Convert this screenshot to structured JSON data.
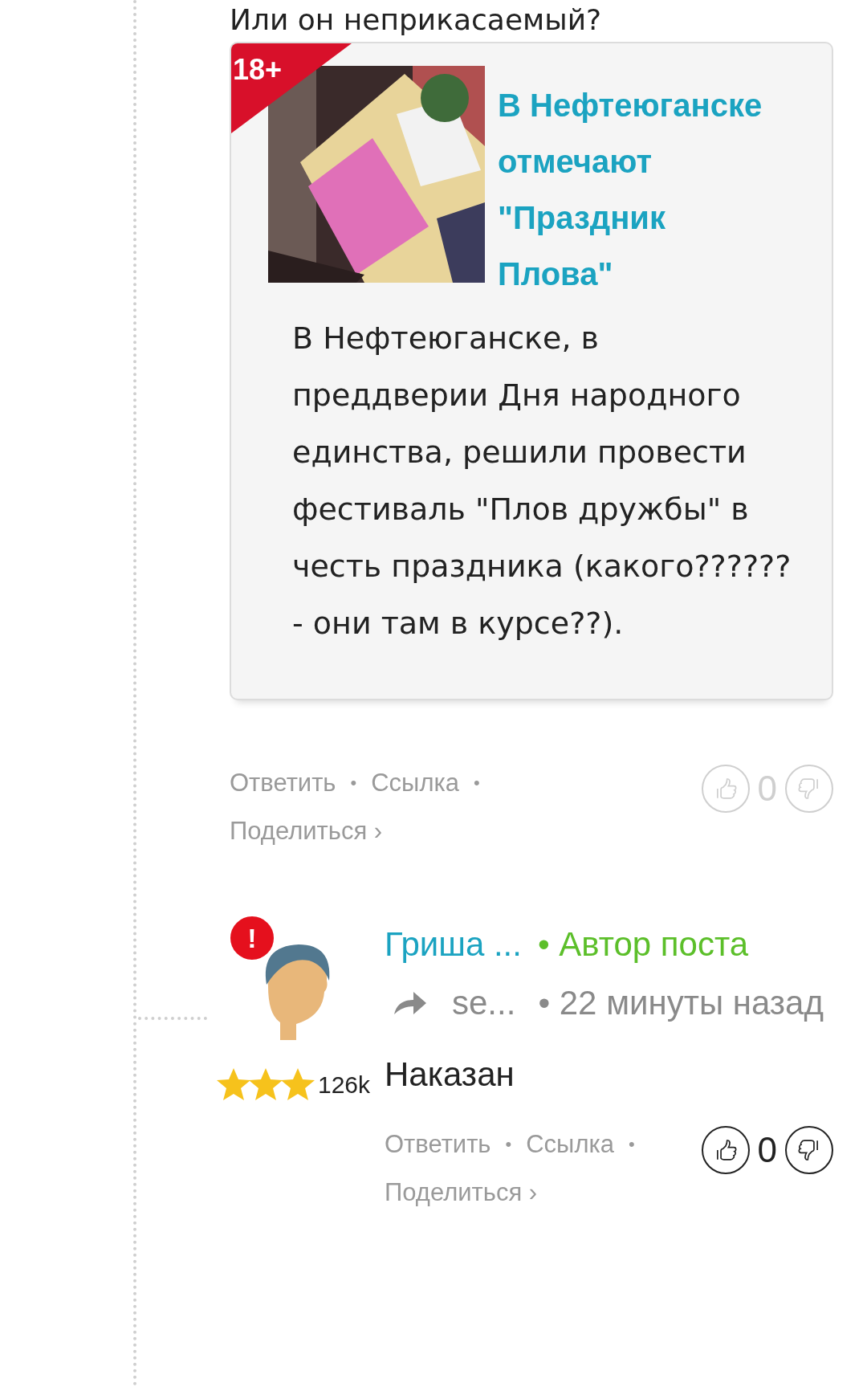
{
  "comments": [
    {
      "text": "Или он неприкасаемый?",
      "link_card": {
        "badge": "18+",
        "title": "В Нефтеюганске отмечают \"Праздник Плова\"",
        "description": "В Нефтеюганске, в преддверии Дня народного единства, решили провести фестиваль \"Плов дружбы\" в честь праздника (какого?????? - они там в курсе??)."
      },
      "actions": {
        "items": [
          "Ответить",
          "Ссылка",
          "Поделиться ›"
        ],
        "separator": "•"
      },
      "votes": {
        "score": "0",
        "disabled": true
      }
    },
    {
      "author": {
        "warning": "!",
        "name": "Гриша ...",
        "role": "• Автор поста",
        "reply_to": "se...",
        "time": "• 22 минуты назад",
        "stars": 3,
        "rating": "126k"
      },
      "text": "Наказан",
      "actions": {
        "items": [
          "Ответить",
          "Ссылка",
          "Поделиться ›"
        ],
        "separator": "•"
      },
      "votes": {
        "score": "0",
        "disabled": false
      }
    }
  ]
}
